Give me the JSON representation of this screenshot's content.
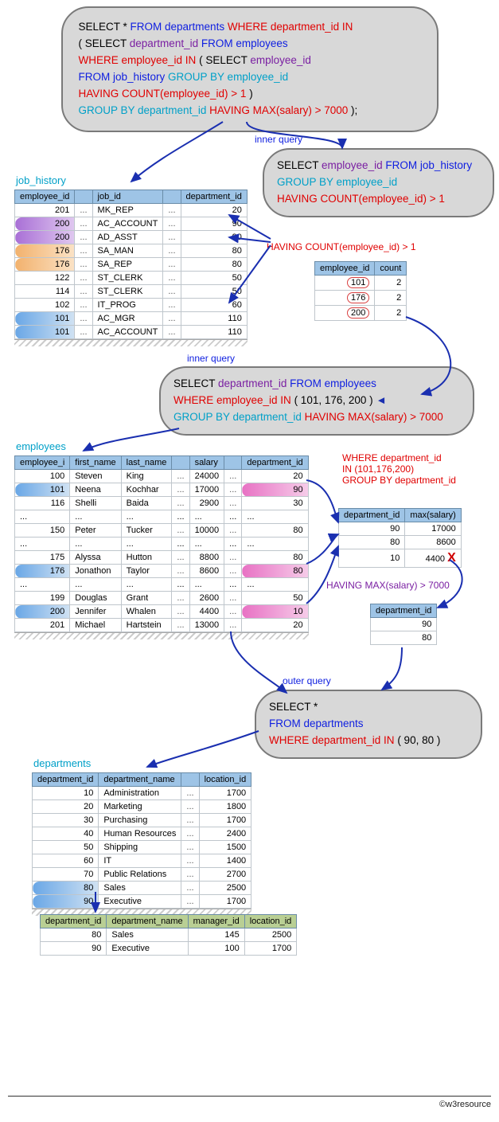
{
  "query_main": {
    "l1": {
      "a": "SELECT * ",
      "b": "FROM departments ",
      "c": "WHERE department_id IN"
    },
    "l2": {
      "a": "( ",
      "b": "SELECT ",
      "c": "department_id ",
      "d": "FROM employees"
    },
    "l3": {
      "a": "WHERE employee_id IN ",
      "b": "( ",
      "c": "SELECT ",
      "d": "employee_id"
    },
    "l4": {
      "a": "FROM job_history ",
      "b": "GROUP BY employee_id"
    },
    "l5": {
      "a": "HAVING COUNT(employee_id) > 1 ",
      "b": ")"
    },
    "l6": {
      "a": "GROUP BY department_id ",
      "b": "HAVING MAX(salary) > 7000 ",
      "c": ");"
    }
  },
  "labels": {
    "inner_query": "inner query",
    "outer_query": "outer query",
    "job_history": "job_history",
    "employees": "employees",
    "departments": "departments",
    "having_count": "HAVING COUNT(employee_id) > 1",
    "where_dept": "WHERE department_id",
    "in_list": "IN (101,176,200)",
    "group_dept": "GROUP BY department_id",
    "having_max": "HAVING MAX(salary) > 7000",
    "footer": "©w3resource"
  },
  "inner1": {
    "p1": {
      "a": "SELECT ",
      "b": "employee_id ",
      "c": "FROM job_history"
    },
    "p2": {
      "a": "GROUP BY employee_id"
    },
    "p3": {
      "a": "HAVING COUNT(employee_id) > 1"
    }
  },
  "inner2": {
    "p1": {
      "a": "SELECT ",
      "b": "department_id ",
      "c": "FROM employees"
    },
    "p2": {
      "a": "WHERE employee_id IN ",
      "b": "( 101, 176, 200 )"
    },
    "p3": {
      "a": "GROUP BY department_id ",
      "b": "HAVING MAX(salary) > 7000"
    }
  },
  "outer": {
    "p1": "SELECT *",
    "p2": "FROM departments",
    "p3a": "WHERE department_id IN ",
    "p3b": "( 90, 80 )"
  },
  "tbl_jobhist": {
    "headers": [
      "employee_id",
      "",
      "job_id",
      "",
      "department_id"
    ],
    "rows": [
      {
        "emp": "201",
        "job": "MK_REP",
        "dept": "20",
        "hi": ""
      },
      {
        "emp": "200",
        "job": "AC_ACCOUNT",
        "dept": "90",
        "hi": "vio"
      },
      {
        "emp": "200",
        "job": "AD_ASST",
        "dept": "90",
        "hi": "vio"
      },
      {
        "emp": "176",
        "job": "SA_MAN",
        "dept": "80",
        "hi": "orn"
      },
      {
        "emp": "176",
        "job": "SA_REP",
        "dept": "80",
        "hi": "orn"
      },
      {
        "emp": "122",
        "job": "ST_CLERK",
        "dept": "50",
        "hi": ""
      },
      {
        "emp": "114",
        "job": "ST_CLERK",
        "dept": "50",
        "hi": ""
      },
      {
        "emp": "102",
        "job": "IT_PROG",
        "dept": "60",
        "hi": ""
      },
      {
        "emp": "101",
        "job": "AC_MGR",
        "dept": "110",
        "hi": "blue"
      },
      {
        "emp": "101",
        "job": "AC_ACCOUNT",
        "dept": "110",
        "hi": "blue"
      }
    ]
  },
  "tbl_count": {
    "headers": [
      "employee_id",
      "count"
    ],
    "rows": [
      {
        "emp": "101",
        "c": "2"
      },
      {
        "emp": "176",
        "c": "2"
      },
      {
        "emp": "200",
        "c": "2"
      }
    ]
  },
  "tbl_emp": {
    "headers": [
      "employee_i",
      "first_name",
      "last_name",
      "",
      "salary",
      "",
      "department_id"
    ],
    "rows": [
      {
        "id": "100",
        "fn": "Steven",
        "ln": "King",
        "sal": "24000",
        "dept": "20",
        "hi": ""
      },
      {
        "id": "101",
        "fn": "Neena",
        "ln": "Kochhar",
        "sal": "17000",
        "dept": "90",
        "hi": "blue",
        "hid": "mag"
      },
      {
        "id": "116",
        "fn": "Shelli",
        "ln": "Baida",
        "sal": "2900",
        "dept": "30",
        "hi": ""
      },
      {
        "gap": true
      },
      {
        "id": "150",
        "fn": "Peter",
        "ln": "Tucker",
        "sal": "10000",
        "dept": "80",
        "hi": ""
      },
      {
        "gap": true
      },
      {
        "id": "175",
        "fn": "Alyssa",
        "ln": "Hutton",
        "sal": "8800",
        "dept": "80",
        "hi": ""
      },
      {
        "id": "176",
        "fn": "Jonathon",
        "ln": "Taylor",
        "sal": "8600",
        "dept": "80",
        "hi": "blue",
        "hid": "mag"
      },
      {
        "gap": true
      },
      {
        "id": "199",
        "fn": "Douglas",
        "ln": "Grant",
        "sal": "2600",
        "dept": "50",
        "hi": ""
      },
      {
        "id": "200",
        "fn": "Jennifer",
        "ln": "Whalen",
        "sal": "4400",
        "dept": "10",
        "hi": "blue",
        "hid": "mag"
      },
      {
        "id": "201",
        "fn": "Michael",
        "ln": "Hartstein",
        "sal": "13000",
        "dept": "20",
        "hi": ""
      }
    ]
  },
  "tbl_maxsal": {
    "headers": [
      "department_id",
      "max(salary)"
    ],
    "rows": [
      {
        "d": "90",
        "m": "17000",
        "x": ""
      },
      {
        "d": "80",
        "m": "8600",
        "x": ""
      },
      {
        "d": "10",
        "m": "4400",
        "x": "X"
      }
    ]
  },
  "tbl_deptid": {
    "headers": [
      "department_id"
    ],
    "rows": [
      {
        "d": "90"
      },
      {
        "d": "80"
      }
    ]
  },
  "tbl_departments": {
    "headers": [
      "department_id",
      "department_name",
      "",
      "location_id"
    ],
    "rows": [
      {
        "id": "10",
        "n": "Administration",
        "loc": "1700",
        "hi": ""
      },
      {
        "id": "20",
        "n": "Marketing",
        "loc": "1800",
        "hi": ""
      },
      {
        "id": "30",
        "n": "Purchasing",
        "loc": "1700",
        "hi": ""
      },
      {
        "id": "40",
        "n": "Human Resources",
        "loc": "2400",
        "hi": ""
      },
      {
        "id": "50",
        "n": "Shipping",
        "loc": "1500",
        "hi": ""
      },
      {
        "id": "60",
        "n": "IT",
        "loc": "1400",
        "hi": ""
      },
      {
        "id": "70",
        "n": "Public Relations",
        "loc": "2700",
        "hi": ""
      },
      {
        "id": "80",
        "n": "Sales",
        "loc": "2500",
        "hi": "blue"
      },
      {
        "id": "90",
        "n": "Executive",
        "loc": "1700",
        "hi": "blue"
      }
    ]
  },
  "tbl_result": {
    "headers": [
      "department_id",
      "department_name",
      "manager_id",
      "location_id"
    ],
    "rows": [
      {
        "id": "80",
        "n": "Sales",
        "m": "145",
        "loc": "2500"
      },
      {
        "id": "90",
        "n": "Executive",
        "m": "100",
        "loc": "1700"
      }
    ]
  },
  "chart_data": {
    "type": "table",
    "description": "SQL nested-subquery explanation diagram. No numeric chart; data tables captured above."
  }
}
